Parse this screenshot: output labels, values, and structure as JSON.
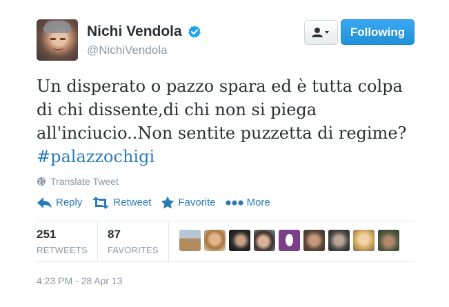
{
  "author": {
    "name": "Nichi Vendola",
    "handle": "@NichiVendola",
    "verified": true
  },
  "buttons": {
    "follow_label": "Following",
    "user_actions_icon": "user-dropdown-icon"
  },
  "tweet": {
    "text": "Un disperato o pazzo spara ed è tutta colpa di chi dissente,di chi non si piega all'inciucio..Non sentite puzzetta di regime?",
    "hashtag": "#palazzochigi"
  },
  "translate_label": "Translate Tweet",
  "actions": [
    {
      "id": "reply",
      "label": "Reply",
      "icon": "reply-icon"
    },
    {
      "id": "retweet",
      "label": "Retweet",
      "icon": "retweet-icon"
    },
    {
      "id": "favorite",
      "label": "Favorite",
      "icon": "star-icon"
    },
    {
      "id": "more",
      "label": "More",
      "icon": "more-dots-icon"
    }
  ],
  "stats": {
    "retweets_value": "251",
    "retweets_label": "RETWEETS",
    "favorites_value": "87",
    "favorites_label": "FAVORITES"
  },
  "timestamp": "4:23 PM - 28 Apr 13",
  "colors": {
    "link": "#2b7bb9",
    "follow_button": "#2a9ae6",
    "muted": "#8899a6",
    "verified": "#1da1f2"
  }
}
